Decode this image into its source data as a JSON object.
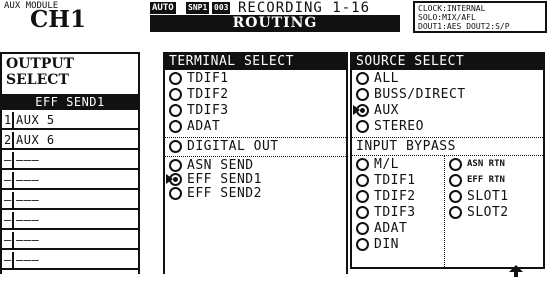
{
  "header": {
    "module_label": "AUX MODULE",
    "channel": "CH1",
    "auto_badge": "AUTO",
    "snp_badge": "SNP1",
    "snp_num": "003",
    "title_line1": "RECORDING 1-16",
    "title_line2": "ROUTING",
    "status": {
      "clock_key": "CLOCK:",
      "clock_val": "INTERNAL",
      "solo_key": "SOLO:",
      "solo_val": "MIX/AFL",
      "dout1_key": "DOUT1:",
      "dout1_val": "AES",
      "dout2_key": "DOUT2:",
      "dout2_val": "S/P"
    }
  },
  "output_select": {
    "title_line1": "OUTPUT",
    "title_line2": "SELECT",
    "header": "EFF SEND1",
    "rows": [
      {
        "num": "1",
        "value": "AUX 5"
      },
      {
        "num": "2",
        "value": "AUX 6"
      },
      {
        "num": "–",
        "value": "–––"
      },
      {
        "num": "–",
        "value": "–––"
      },
      {
        "num": "–",
        "value": "–––"
      },
      {
        "num": "–",
        "value": "–––"
      },
      {
        "num": "–",
        "value": "–––"
      },
      {
        "num": "–",
        "value": "–––"
      }
    ]
  },
  "terminal_select": {
    "title": "TERMINAL SELECT",
    "options": [
      "TDIF1",
      "TDIF2",
      "TDIF3",
      "ADAT"
    ],
    "digital_out": "DIGITAL OUT",
    "send_options": [
      "ASN SEND",
      "EFF SEND1",
      "EFF SEND2"
    ],
    "selected_send": 1
  },
  "source_select": {
    "title": "SOURCE SELECT",
    "options": [
      "ALL",
      "BUSS/DIRECT",
      "AUX",
      "STEREO"
    ],
    "selected": 2
  },
  "input_bypass": {
    "title": "INPUT BYPASS",
    "left": [
      "M/L",
      "TDIF1",
      "TDIF2",
      "TDIF3",
      "ADAT",
      "DIN"
    ],
    "right": [
      "ASN RTN",
      "EFF RTN",
      "SLOT1",
      "SLOT2"
    ]
  },
  "scroll_arrow": "up-arrow-icon"
}
